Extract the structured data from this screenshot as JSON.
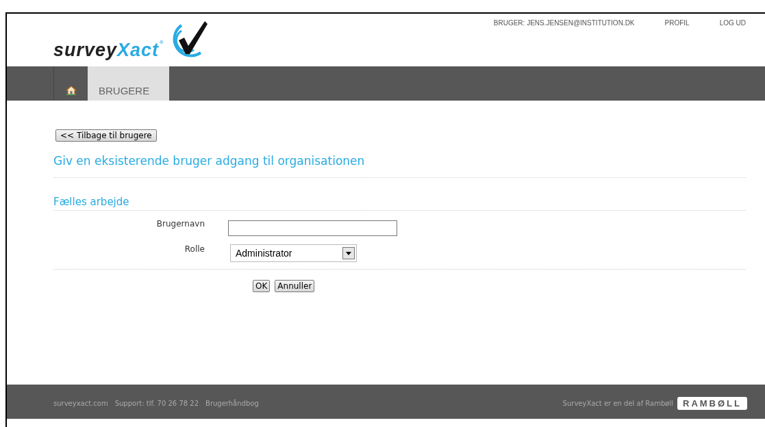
{
  "header": {
    "logo": {
      "part_1": "survey",
      "part_2": "Xact",
      "mark": "®"
    },
    "user": "BRUGER: JENS.JENSEN@INSTITUTION.DK",
    "links": [
      "PROFIL",
      "LOG UD"
    ]
  },
  "nav": {
    "tabs": [
      {
        "kind": "home",
        "selected": false
      },
      {
        "kind": "text",
        "label": "BRUGERE",
        "selected": true
      }
    ]
  },
  "back_button": "<< Tilbage til brugere",
  "heading": "Giv en eksisterende bruger adgang til organisationen",
  "section": {
    "title": "Fælles arbejde",
    "fields": [
      {
        "kind": "text",
        "label": "Brugernavn"
      },
      {
        "kind": "select",
        "label": "Rolle",
        "value": "Administrator"
      }
    ]
  },
  "buttons": [
    "OK",
    "Annuller"
  ],
  "footer": {
    "links": [
      "surveyxact.com",
      "Support: tlf. 70 26 78 22",
      "Brugerhåndbog"
    ],
    "note": "SurveyXact er en del af  Rambøll",
    "brand": "RAMBØLL"
  }
}
